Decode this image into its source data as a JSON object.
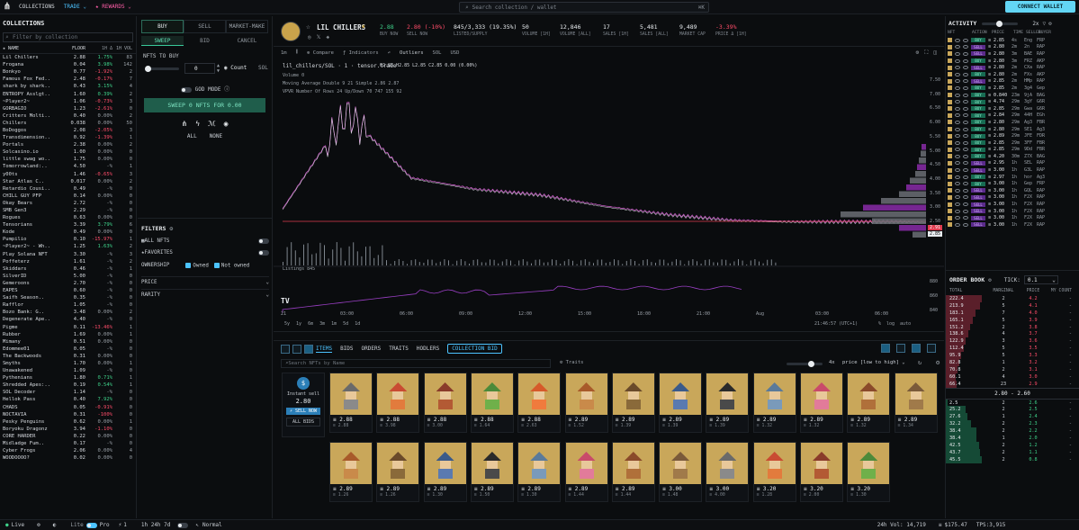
{
  "topbar": {
    "collections": "COLLECTIONS",
    "trade": "TRADE ⌄",
    "rewards": "★ REWARDS ⌄",
    "search_placeholder": "Search collection / wallet",
    "search_kbd": "⌘K",
    "connect": "CONNECT WALLET"
  },
  "collections": {
    "title": "COLLECTIONS",
    "filter_placeholder": "Filter by collection",
    "headers": [
      "★ NAME",
      "FLOOR",
      "1H Δ",
      "1H VOL"
    ],
    "rows": [
      [
        "Lil Chillers",
        "2.88",
        "1.75%",
        "83"
      ],
      [
        "Frogana",
        "0.04",
        "3.98%",
        "142"
      ],
      [
        "Bonkyo",
        "0.77",
        "-1.92%",
        "2"
      ],
      [
        "Famous Fox Fed..",
        "2.48",
        "-0.17%",
        "7"
      ],
      [
        "shark by shark..",
        "0.43",
        "3.15%",
        "4"
      ],
      [
        "ENTROPY Asslgt..",
        "1.60",
        "0.39%",
        "2"
      ],
      [
        "~Player2~",
        "1.06",
        "-0.73%",
        "3"
      ],
      [
        "GORBAGIO",
        "1.23",
        "-2.61%",
        "0"
      ],
      [
        "Critters Molti..",
        "0.40",
        "0.00%",
        "2"
      ],
      [
        "Chillers",
        "0.038",
        "0.00%",
        "50"
      ],
      [
        "BoDoggos",
        "2.08",
        "-2.05%",
        "3"
      ],
      [
        "Transdimension..",
        "0.92",
        "-1.39%",
        "1"
      ],
      [
        "Portals",
        "2.38",
        "0.00%",
        "2"
      ],
      [
        "Solcasino.io",
        "1.00",
        "0.00%",
        "0"
      ],
      [
        "little swag wo..",
        "1.75",
        "0.00%",
        "0"
      ],
      [
        "Tomorrowland:..",
        "4.50",
        "-%",
        "1"
      ],
      [
        "y00ts",
        "1.46",
        "-0.65%",
        "3"
      ],
      [
        "Star Atlas C..",
        "0.017",
        "0.00%",
        "2"
      ],
      [
        "Retardio Cousi..",
        "0.49",
        "-%",
        "0"
      ],
      [
        "CHILL GUY PFP",
        "0.14",
        "0.00%",
        "0"
      ],
      [
        "Okay Bears",
        "2.72",
        "-%",
        "0"
      ],
      [
        "SMB Gen3",
        "2.29",
        "-%",
        "0"
      ],
      [
        "Rogues",
        "0.63",
        "0.00%",
        "0"
      ],
      [
        "Tensorians",
        "3.39",
        "3.79%",
        "6"
      ],
      [
        "Kode",
        "0.49",
        "0.00%",
        "0"
      ],
      [
        "Pumpilio",
        "0.10",
        "-15.97%",
        "1"
      ],
      [
        "~Player2~ - Wh..",
        "1.25",
        "1.63%",
        "2"
      ],
      [
        "Play Solana NFT",
        "3.30",
        "-%",
        "3"
      ],
      [
        "Poffeterz",
        "1.61",
        "-%",
        "2"
      ],
      [
        "Skiddars",
        "0.46",
        "-%",
        "1"
      ],
      [
        "SilverID",
        "5.00",
        "-%",
        "0"
      ],
      [
        "Gemeroons",
        "2.70",
        "-%",
        "0"
      ],
      [
        "EAPES",
        "0.60",
        "-%",
        "0"
      ],
      [
        "Saifh Season..",
        "0.35",
        "-%",
        "0"
      ],
      [
        "Rafflor",
        "1.05",
        "-%",
        "0"
      ],
      [
        "Bozo Bank: G..",
        "3.48",
        "0.00%",
        "2"
      ],
      [
        "Degenerate Ape..",
        "4.40",
        "-%",
        "0"
      ],
      [
        "Pigme",
        "0.11",
        "-13.46%",
        "1"
      ],
      [
        "Rubber",
        "1.69",
        "0.00%",
        "1"
      ],
      [
        "Mimany",
        "0.51",
        "0.00%",
        "0"
      ],
      [
        "Edommee01",
        "0.05",
        "-%",
        "0"
      ],
      [
        "The Backwoods",
        "0.31",
        "0.00%",
        "0"
      ],
      [
        "Smyths",
        "1.70",
        "0.00%",
        "1"
      ],
      [
        "Unawakened",
        "1.09",
        "-%",
        "0"
      ],
      [
        "Pythenians",
        "1.80",
        "0.71%",
        "1"
      ],
      [
        "Shredded Apes:..",
        "0.19",
        "0.54%",
        "1"
      ],
      [
        "SOL Decoder",
        "1.14",
        "-%",
        "0"
      ],
      [
        "Hellok Pass",
        "0.40",
        "7.92%",
        "0"
      ],
      [
        "CHADS",
        "0.05",
        "-0.91%",
        "0"
      ],
      [
        "NOCTAVIA",
        "0.31",
        "-100%",
        "0"
      ],
      [
        "Pesky Penguins",
        "0.62",
        "0.00%",
        "1"
      ],
      [
        "Boryoku Dragonz",
        "3.94",
        "-1.10%",
        "0"
      ],
      [
        "CORE HARDER",
        "0.22",
        "0.00%",
        "0"
      ],
      [
        "Midladge Fum..",
        "0.17",
        "-%",
        "0"
      ],
      [
        "Cyber Frogs",
        "2.06",
        "0.00%",
        "4"
      ],
      [
        "WOODOOOO?",
        "0.02",
        "0.00%",
        "0"
      ]
    ]
  },
  "buy": {
    "tabs": [
      "BUY",
      "SELL",
      "MARKET-MAKE"
    ],
    "subtabs": [
      "SWEEP",
      "BID",
      "CANCEL"
    ],
    "nfts_label": "NFTS TO BUY",
    "count_value": "0",
    "count_label": "Count",
    "sol_label": "SOL",
    "god_mode": "GOD MODE ⓘ",
    "sweep_button": "SWEEP 0 NFTS FOR 0.00",
    "all": "ALL",
    "none": "NONE",
    "filters_title": "FILTERS",
    "all_nfts": "ALL NFTS",
    "favorites": "FAVORITES",
    "ownership": "OWNERSHIP",
    "owned": "Owned",
    "not_owned": "Not owned",
    "price": "PRICE",
    "rarity": "RARITY"
  },
  "header": {
    "name": "LIL CHILLERS",
    "stats": [
      {
        "v": "2.88",
        "l": "BUY NOW"
      },
      {
        "v": "2.80 (-10%)",
        "l": "SELL NOW"
      },
      {
        "v": "845/3,333 (19.35%)",
        "l": "LISTED/SUPPLY"
      },
      {
        "v": "50",
        "l": "VOLUME [1H]"
      },
      {
        "v": "12,846",
        "l": "VOLUME [ALL]"
      },
      {
        "v": "17",
        "l": "SALES [1H]"
      },
      {
        "v": "5,481",
        "l": "SALES [ALL]"
      },
      {
        "v": "9,489",
        "l": "MARKET CAP"
      },
      {
        "v": "-3.39%",
        "l": "PRICE Δ [1H]"
      }
    ]
  },
  "chart": {
    "tf": "1m",
    "compare": "Compare",
    "indicators": "Indicators",
    "outliers": "Outliers",
    "sol": "SOL",
    "usd": "USD",
    "symbol": "lil_chillers/SOL · 1 · tensor.trade",
    "ohlc": "O2.85  H2.85  L2.85  C2.85  0.00 (0.00%)",
    "volume": "Volume  0",
    "ma": "Moving Average Double 9 21 Simple  2.86  2.87",
    "vpvr": "VPVR Number Of Rows 24 Up/Down 70  747  155  92",
    "listings": "Listings  845",
    "price_axis": [
      "7.50",
      "7.00",
      "6.50",
      "6.00",
      "5.50",
      "5.00",
      "4.50",
      "4.00",
      "3.50",
      "3.00",
      "2.50"
    ],
    "time_axis": [
      "21",
      "03:00",
      "06:00",
      "09:00",
      "12:00",
      "15:00",
      "18:00",
      "21:00",
      "Aug",
      "03:00",
      "06:00"
    ],
    "listing_axis": [
      "880",
      "860",
      "840"
    ],
    "ranges": [
      "5y",
      "1y",
      "6m",
      "3m",
      "1m",
      "5d",
      "1d"
    ],
    "clock": "21:46:57 (UTC+1)",
    "pct": "%",
    "log": "log",
    "auto": "auto",
    "price_tag": "2.85",
    "price_tag2": "2.91"
  },
  "chart_data": {
    "type": "line",
    "title": "lil_chillers/SOL · 1 · tensor.trade",
    "x": [
      "21",
      "03:00",
      "06:00",
      "09:00",
      "12:00",
      "15:00",
      "18:00",
      "21:00",
      "Aug",
      "03:00",
      "06:00"
    ],
    "series": [
      {
        "name": "price",
        "values": [
          3.3,
          6.7,
          4.4,
          4.0,
          3.8,
          3.4,
          3.1,
          2.9,
          2.85,
          2.85,
          2.85
        ]
      }
    ],
    "ylim": [
      2.5,
      7.5
    ]
  },
  "grid": {
    "tabs": [
      "ITEMS",
      "BIDS",
      "ORDERS",
      "TRAITS",
      "HODLERS"
    ],
    "collection_bid": "COLLECTION BID",
    "search_placeholder": "Search NFTs by Name",
    "traits": "Traits",
    "size": "4x",
    "sort": "price [low to high]",
    "instant_sell": "Instant sell",
    "instant_value": "2.80",
    "sell_now": "⚡ SELL NOW",
    "all_bids": "ALL BIDS",
    "row1": [
      [
        "2.88",
        "2.88"
      ],
      [
        "2.88",
        "3.98"
      ],
      [
        "2.88",
        "3.00"
      ],
      [
        "2.88",
        "1.64"
      ],
      [
        "2.88",
        "2.63"
      ],
      [
        "2.89",
        "1.52"
      ],
      [
        "2.89",
        "1.39"
      ],
      [
        "2.89",
        "1.39"
      ],
      [
        "2.89",
        "1.39"
      ],
      [
        "2.89",
        "1.32"
      ],
      [
        "2.89",
        "1.32"
      ],
      [
        "2.89",
        "1.32"
      ],
      [
        "2.89",
        "1.34"
      ]
    ],
    "row2": [
      [
        "2.89",
        "1.26"
      ],
      [
        "2.89",
        "1.26"
      ],
      [
        "2.89",
        "1.30"
      ],
      [
        "2.89",
        "1.50"
      ],
      [
        "2.89",
        "1.30"
      ],
      [
        "2.89",
        "1.44"
      ],
      [
        "2.89",
        "1.44"
      ],
      [
        "3.00",
        "1.48"
      ],
      [
        "3.00",
        "4.00"
      ],
      [
        "3.20",
        "1.28"
      ],
      [
        "3.20",
        "2.00"
      ],
      [
        "3.20",
        "1.30"
      ]
    ]
  },
  "activity": {
    "title": "ACTIVITY",
    "size": "2x",
    "headers": [
      "NFT",
      "ACTION",
      "PRICE",
      "TIME",
      "SELLER",
      "BUYER"
    ],
    "rows": [
      [
        "BUY",
        "2.85",
        "4s",
        "Eng",
        "FRP"
      ],
      [
        "SELL",
        "2.80",
        "2m",
        "2n",
        "RAP"
      ],
      [
        "SELL",
        "2.80",
        "3m",
        "BAE",
        "RAP"
      ],
      [
        "BUY",
        "2.80",
        "3m",
        "FRZ",
        "AKP"
      ],
      [
        "SELL",
        "2.80",
        "2m",
        "CXa",
        "RAP"
      ],
      [
        "BUY",
        "2.80",
        "2m",
        "FXs",
        "AKP"
      ],
      [
        "SELL",
        "2.85",
        "2m",
        "HMp",
        "RAP"
      ],
      [
        "BUY",
        "2.85",
        "2m",
        "3g4",
        "Gep"
      ],
      [
        "BUY",
        "0.840",
        "23m",
        "9jA",
        "BAG"
      ],
      [
        "BUY",
        "4.74",
        "29m",
        "3gY",
        "G6R"
      ],
      [
        "BUY",
        "2.85",
        "29m",
        "Gwa",
        "G6R"
      ],
      [
        "BUY",
        "2.84",
        "29m",
        "44H",
        "EGh"
      ],
      [
        "BUY",
        "2.80",
        "29m",
        "Ag3",
        "FBR"
      ],
      [
        "BUY",
        "2.80",
        "29m",
        "SE1",
        "Ag3"
      ],
      [
        "BUY",
        "2.89",
        "29m",
        "JFE",
        "FDR"
      ],
      [
        "BUY",
        "2.85",
        "29m",
        "3FF",
        "FBR"
      ],
      [
        "BUY",
        "2.85",
        "29m",
        "9Dd",
        "FBR"
      ],
      [
        "BUY",
        "4.20",
        "30m",
        "Z7X",
        "BAG"
      ],
      [
        "SELL",
        "2.95",
        "1h",
        "SEL",
        "RAP"
      ],
      [
        "SELL",
        "3.00",
        "1h",
        "G3L",
        "RAP"
      ],
      [
        "BUY",
        "2.97",
        "1h",
        "hor",
        "Ag3"
      ],
      [
        "BUY",
        "3.00",
        "1h",
        "Gep",
        "FRP"
      ],
      [
        "SELL",
        "3.00",
        "1h",
        "GQL",
        "RAP"
      ],
      [
        "SELL",
        "3.00",
        "1h",
        "F2X",
        "RAP"
      ],
      [
        "SELL",
        "3.00",
        "1h",
        "F2X",
        "RAP"
      ],
      [
        "SELL",
        "3.00",
        "1h",
        "F2X",
        "RAP"
      ],
      [
        "SELL",
        "3.00",
        "1h",
        "F2X",
        "RAP"
      ],
      [
        "SELL",
        "3.00",
        "1h",
        "F2X",
        "RAP"
      ]
    ]
  },
  "orderbook": {
    "title": "ORDER BOOK",
    "tick_label": "TICK:",
    "tick_value": "0.1",
    "headers": [
      "TOTAL",
      "MARGINAL",
      "PRICE",
      "MY COUNT"
    ],
    "asks": [
      [
        "222.4",
        "2",
        "4.2",
        "-"
      ],
      [
        "213.9",
        "5",
        "4.1",
        "-"
      ],
      [
        "183.1",
        "7",
        "4.0",
        "-"
      ],
      [
        "165.1",
        "5",
        "3.9",
        "-"
      ],
      [
        "151.2",
        "2",
        "3.8",
        "-"
      ],
      [
        "138.6",
        "4",
        "3.7",
        "-"
      ],
      [
        "122.9",
        "3",
        "3.6",
        "-"
      ],
      [
        "112.4",
        "5",
        "3.5",
        "-"
      ],
      [
        "95.9",
        "5",
        "3.3",
        "-"
      ],
      [
        "82.8",
        "1",
        "3.2",
        "-"
      ],
      [
        "70.8",
        "2",
        "3.1",
        "-"
      ],
      [
        "60.1",
        "4",
        "3.0",
        "-"
      ],
      [
        "66.4",
        "23",
        "2.9",
        "-"
      ]
    ],
    "spread": "2.80 - 2.60",
    "bids": [
      [
        "2.5",
        "2",
        "2.6",
        "-"
      ],
      [
        "25.2",
        "2",
        "2.5",
        "-"
      ],
      [
        "27.6",
        "1",
        "2.4",
        "-"
      ],
      [
        "32.2",
        "2",
        "2.3",
        "-"
      ],
      [
        "38.4",
        "2",
        "2.2",
        "-"
      ],
      [
        "38.4",
        "1",
        "2.0",
        "-"
      ],
      [
        "42.5",
        "2",
        "1.2",
        "-"
      ],
      [
        "43.7",
        "2",
        "1.1",
        "-"
      ],
      [
        "45.5",
        "2",
        "0.8",
        "-"
      ]
    ]
  },
  "bottombar": {
    "live": "Live",
    "lite": "Lite",
    "pro": "Pro",
    "one": "1",
    "tf": "1h  24h  7d",
    "normal": "Normal",
    "vol": "24h Vol: 14,719",
    "sol_price": "$175.47",
    "tps": "TPS:3,915"
  }
}
